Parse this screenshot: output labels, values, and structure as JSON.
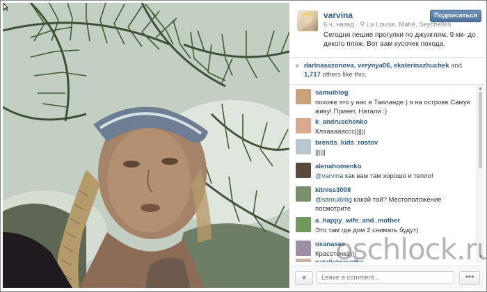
{
  "post": {
    "username": "varvina",
    "time_ago": "6 ч. назад",
    "location": "La Louise, Mahé, Seychelles",
    "location_icon": "pin-icon",
    "follow_label": "Подписаться",
    "caption": "Сегодня пешие прогулки по джунглям. 9 км- до дикого пляж. Вот вам кусочек похода."
  },
  "likes": {
    "names": "darinasazonova, verynya06, ekaterinazhuchek",
    "and_text": " and",
    "count": "1,717",
    "suffix": " others like this.",
    "icon": "heart-icon"
  },
  "comments": [
    {
      "user": "samuiblog",
      "text": "похоже это у нас в Таиланде ) я на острове Самуи живу! Привет, Натали :)",
      "avatar_color": "#c8a27a"
    },
    {
      "user": "k_andruschenko",
      "text": "Клааааааccc||||||",
      "avatar_color": "#d9a98c"
    },
    {
      "user": "brends_kids_rostov",
      "text": "||||||",
      "avatar_color": "#b7c7cf"
    },
    {
      "user": "alenahomenko",
      "mention": "@varvina",
      "text": " как вам там хорошо и тепло!",
      "avatar_color": "#5a4a3e"
    },
    {
      "user": "kitniss3008",
      "mention": "@samuiblog",
      "text": " какой тай? Местоположение посмотрите",
      "avatar_color": "#7a8f6b"
    },
    {
      "user": "a_happy_wife_and_mother",
      "text": "Это там где дом 2 снимать будут)",
      "avatar_color": "#6f9a5c"
    },
    {
      "user": "oxanasee",
      "text": "Красоточка)))",
      "avatar_color": "#9b8fa6"
    },
    {
      "user": "nataliakrasotka",
      "text": "",
      "avatar_color": "#c9b1a0"
    }
  ],
  "footer": {
    "like_icon": "heart-icon",
    "comment_placeholder": "Leave a comment...",
    "more_label": "•••"
  },
  "watermark": "oschlock.ru",
  "colors": {
    "link": "#2b5a85",
    "follow_bg": "#4d7299"
  }
}
